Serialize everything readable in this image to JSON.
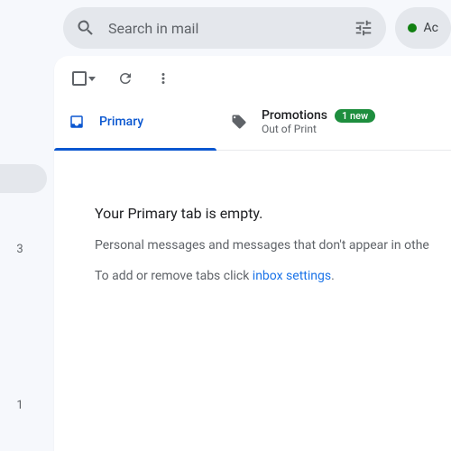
{
  "search": {
    "placeholder": "Search in mail"
  },
  "status": {
    "label": "Ac"
  },
  "sidebar": {
    "count1": "3",
    "count2": "1"
  },
  "tabs": {
    "primary": {
      "label": "Primary"
    },
    "promotions": {
      "label": "Promotions",
      "badge": "1 new",
      "sub": "Out of Print"
    }
  },
  "empty": {
    "title": "Your Primary tab is empty.",
    "sub": "Personal messages and messages that don't appear in othe",
    "action_prefix": "To add or remove tabs click ",
    "link": "inbox settings",
    "action_suffix": "."
  }
}
